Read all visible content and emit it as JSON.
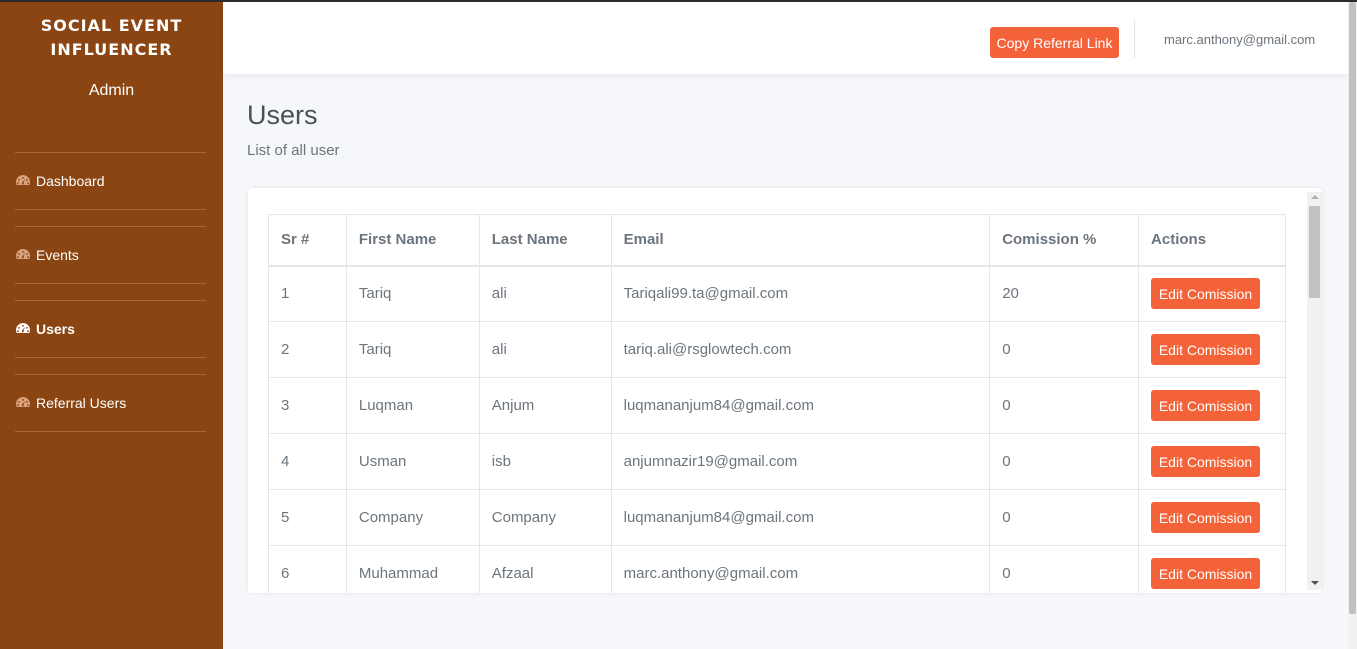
{
  "sidebar": {
    "brand_line1": "SOCIAL EVENT",
    "brand_line2": "INFLUENCER",
    "role": "Admin",
    "items": [
      {
        "label": "Dashboard",
        "icon": "dashboard-gauge-icon",
        "active": false
      },
      {
        "label": "Events",
        "icon": "dashboard-gauge-icon",
        "active": false
      },
      {
        "label": "Users",
        "icon": "dashboard-gauge-icon",
        "active": true
      },
      {
        "label": "Referral Users",
        "icon": "dashboard-gauge-icon",
        "active": false
      }
    ],
    "colors": {
      "background": "#8b4513",
      "text": "#ffffff"
    }
  },
  "header": {
    "copy_referral_label": "Copy Referral Link",
    "user_email": "marc.anthony@gmail.com"
  },
  "main": {
    "title": "Users",
    "subtitle": "List of all user"
  },
  "table": {
    "columns": [
      "Sr #",
      "First Name",
      "Last Name",
      "Email",
      "Comission %",
      "Actions"
    ],
    "rows": [
      {
        "sr": "1",
        "first_name": "Tariq",
        "last_name": "ali",
        "email": "Tariqali99.ta@gmail.com",
        "commission": "20",
        "action": "Edit Comission"
      },
      {
        "sr": "2",
        "first_name": "Tariq",
        "last_name": "ali",
        "email": "tariq.ali@rsglowtech.com",
        "commission": "0",
        "action": "Edit Comission"
      },
      {
        "sr": "3",
        "first_name": "Luqman",
        "last_name": "Anjum",
        "email": "luqmananjum84@gmail.com",
        "commission": "0",
        "action": "Edit Comission"
      },
      {
        "sr": "4",
        "first_name": "Usman",
        "last_name": "isb",
        "email": "anjumnazir19@gmail.com",
        "commission": "0",
        "action": "Edit Comission"
      },
      {
        "sr": "5",
        "first_name": "Company",
        "last_name": "Company",
        "email": "luqmananjum84@gmail.com",
        "commission": "0",
        "action": "Edit Comission"
      },
      {
        "sr": "6",
        "first_name": "Muhammad",
        "last_name": "Afzaal",
        "email": "marc.anthony@gmail.com",
        "commission": "0",
        "action": "Edit Comission"
      }
    ]
  },
  "colors": {
    "accent": "#f4623a",
    "page_background": "#f6f7fb"
  }
}
